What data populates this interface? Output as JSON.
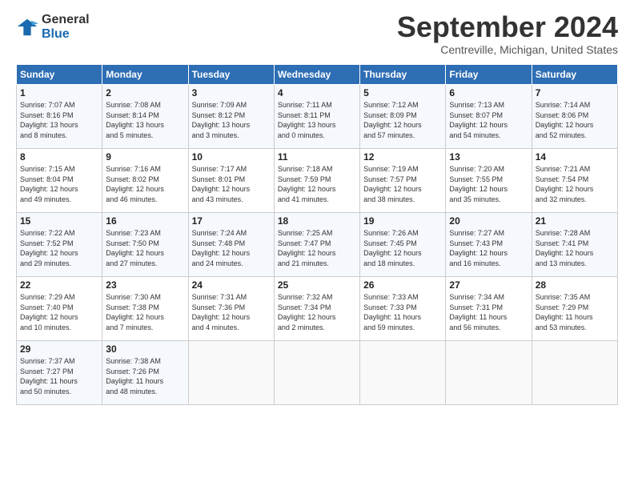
{
  "logo": {
    "line1": "General",
    "line2": "Blue"
  },
  "title": "September 2024",
  "location": "Centreville, Michigan, United States",
  "days_header": [
    "Sunday",
    "Monday",
    "Tuesday",
    "Wednesday",
    "Thursday",
    "Friday",
    "Saturday"
  ],
  "weeks": [
    [
      {
        "day": "1",
        "info": "Sunrise: 7:07 AM\nSunset: 8:16 PM\nDaylight: 13 hours\nand 8 minutes."
      },
      {
        "day": "2",
        "info": "Sunrise: 7:08 AM\nSunset: 8:14 PM\nDaylight: 13 hours\nand 5 minutes."
      },
      {
        "day": "3",
        "info": "Sunrise: 7:09 AM\nSunset: 8:12 PM\nDaylight: 13 hours\nand 3 minutes."
      },
      {
        "day": "4",
        "info": "Sunrise: 7:11 AM\nSunset: 8:11 PM\nDaylight: 13 hours\nand 0 minutes."
      },
      {
        "day": "5",
        "info": "Sunrise: 7:12 AM\nSunset: 8:09 PM\nDaylight: 12 hours\nand 57 minutes."
      },
      {
        "day": "6",
        "info": "Sunrise: 7:13 AM\nSunset: 8:07 PM\nDaylight: 12 hours\nand 54 minutes."
      },
      {
        "day": "7",
        "info": "Sunrise: 7:14 AM\nSunset: 8:06 PM\nDaylight: 12 hours\nand 52 minutes."
      }
    ],
    [
      {
        "day": "8",
        "info": "Sunrise: 7:15 AM\nSunset: 8:04 PM\nDaylight: 12 hours\nand 49 minutes."
      },
      {
        "day": "9",
        "info": "Sunrise: 7:16 AM\nSunset: 8:02 PM\nDaylight: 12 hours\nand 46 minutes."
      },
      {
        "day": "10",
        "info": "Sunrise: 7:17 AM\nSunset: 8:01 PM\nDaylight: 12 hours\nand 43 minutes."
      },
      {
        "day": "11",
        "info": "Sunrise: 7:18 AM\nSunset: 7:59 PM\nDaylight: 12 hours\nand 41 minutes."
      },
      {
        "day": "12",
        "info": "Sunrise: 7:19 AM\nSunset: 7:57 PM\nDaylight: 12 hours\nand 38 minutes."
      },
      {
        "day": "13",
        "info": "Sunrise: 7:20 AM\nSunset: 7:55 PM\nDaylight: 12 hours\nand 35 minutes."
      },
      {
        "day": "14",
        "info": "Sunrise: 7:21 AM\nSunset: 7:54 PM\nDaylight: 12 hours\nand 32 minutes."
      }
    ],
    [
      {
        "day": "15",
        "info": "Sunrise: 7:22 AM\nSunset: 7:52 PM\nDaylight: 12 hours\nand 29 minutes."
      },
      {
        "day": "16",
        "info": "Sunrise: 7:23 AM\nSunset: 7:50 PM\nDaylight: 12 hours\nand 27 minutes."
      },
      {
        "day": "17",
        "info": "Sunrise: 7:24 AM\nSunset: 7:48 PM\nDaylight: 12 hours\nand 24 minutes."
      },
      {
        "day": "18",
        "info": "Sunrise: 7:25 AM\nSunset: 7:47 PM\nDaylight: 12 hours\nand 21 minutes."
      },
      {
        "day": "19",
        "info": "Sunrise: 7:26 AM\nSunset: 7:45 PM\nDaylight: 12 hours\nand 18 minutes."
      },
      {
        "day": "20",
        "info": "Sunrise: 7:27 AM\nSunset: 7:43 PM\nDaylight: 12 hours\nand 16 minutes."
      },
      {
        "day": "21",
        "info": "Sunrise: 7:28 AM\nSunset: 7:41 PM\nDaylight: 12 hours\nand 13 minutes."
      }
    ],
    [
      {
        "day": "22",
        "info": "Sunrise: 7:29 AM\nSunset: 7:40 PM\nDaylight: 12 hours\nand 10 minutes."
      },
      {
        "day": "23",
        "info": "Sunrise: 7:30 AM\nSunset: 7:38 PM\nDaylight: 12 hours\nand 7 minutes."
      },
      {
        "day": "24",
        "info": "Sunrise: 7:31 AM\nSunset: 7:36 PM\nDaylight: 12 hours\nand 4 minutes."
      },
      {
        "day": "25",
        "info": "Sunrise: 7:32 AM\nSunset: 7:34 PM\nDaylight: 12 hours\nand 2 minutes."
      },
      {
        "day": "26",
        "info": "Sunrise: 7:33 AM\nSunset: 7:33 PM\nDaylight: 11 hours\nand 59 minutes."
      },
      {
        "day": "27",
        "info": "Sunrise: 7:34 AM\nSunset: 7:31 PM\nDaylight: 11 hours\nand 56 minutes."
      },
      {
        "day": "28",
        "info": "Sunrise: 7:35 AM\nSunset: 7:29 PM\nDaylight: 11 hours\nand 53 minutes."
      }
    ],
    [
      {
        "day": "29",
        "info": "Sunrise: 7:37 AM\nSunset: 7:27 PM\nDaylight: 11 hours\nand 50 minutes."
      },
      {
        "day": "30",
        "info": "Sunrise: 7:38 AM\nSunset: 7:26 PM\nDaylight: 11 hours\nand 48 minutes."
      },
      {
        "day": "",
        "info": ""
      },
      {
        "day": "",
        "info": ""
      },
      {
        "day": "",
        "info": ""
      },
      {
        "day": "",
        "info": ""
      },
      {
        "day": "",
        "info": ""
      }
    ]
  ]
}
